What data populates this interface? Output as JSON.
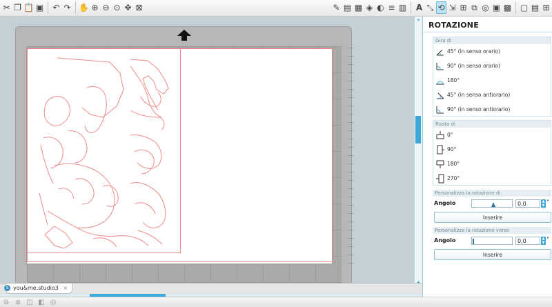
{
  "toolbar": {
    "left_icons": [
      "cut-icon",
      "copy-icon",
      "paste-icon",
      "delete-icon",
      "undo-icon",
      "redo-icon",
      "pan-icon",
      "zoom-in-icon",
      "zoom-out-icon",
      "zoom-select-icon",
      "move-icon",
      "fit-page-icon"
    ],
    "right_icons": [
      "pen-icon",
      "fill-icon",
      "line-color-icon",
      "line-style-icon",
      "shadow-icon",
      "pattern-icon",
      "text-style-icon",
      "transform-icon",
      "rotate-icon",
      "scale-icon",
      "move-icon",
      "replicate-icon",
      "modify-icon",
      "trace-icon",
      "offset-icon",
      "page-setup-icon",
      "cut-settings-icon",
      "send-icon"
    ]
  },
  "document": {
    "tab_label": "you&me.studio3"
  },
  "panel": {
    "title": "ROTAZIONE",
    "gira_di": {
      "header": "Gira di",
      "options": [
        {
          "label": "45° (in senso orario)"
        },
        {
          "label": "90° (in senso orario)"
        },
        {
          "label": "180°"
        },
        {
          "label": "45° (in senso antiorario)"
        },
        {
          "label": "90° (in senso antiorario)"
        }
      ]
    },
    "ruota_di": {
      "header": "Ruota di",
      "options": [
        {
          "label": "0°"
        },
        {
          "label": "90°"
        },
        {
          "label": "180°"
        },
        {
          "label": "270°"
        }
      ]
    },
    "custom_rotation": {
      "header": "Personalizza la rotazione di",
      "angle_label": "Angolo",
      "angle_value": "0,0",
      "insert_label": "Inserire"
    },
    "custom_rotation_to": {
      "header": "Personalizza la rotazione verso",
      "angle_label": "Angolo",
      "angle_value": "0,0",
      "insert_label": "Inserire"
    }
  },
  "colors": {
    "accent": "#3aa7d8",
    "cut_line": "#ee8a8a",
    "mat": "#b7b7b7"
  }
}
